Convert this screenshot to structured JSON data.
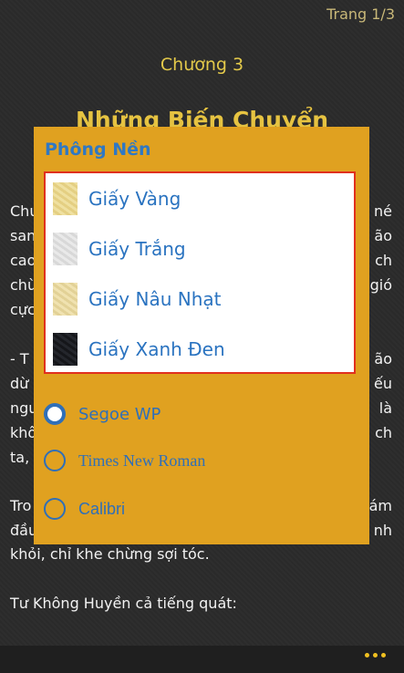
{
  "reader": {
    "page_indicator": "Trang 1/3",
    "chapter_label": "Chương 3",
    "chapter_title": "Những Biến Chuyển",
    "body_left": [
      "Chu",
      "san",
      "cao",
      "chù",
      "cực",
      "-  T",
      "dừ",
      "ngu",
      "khô",
      "ta,",
      "Tro",
      "đầu"
    ],
    "body_right": [
      "né",
      "ão",
      "ch",
      "gió",
      "ão",
      "ếu",
      "là",
      "ch",
      "ám",
      "nh"
    ],
    "line_khoi": "khỏi, chỉ khe chừng sợi tóc.",
    "line_tu": "Tư Không Huyền cả tiếng quát:"
  },
  "dialog": {
    "title": "Phông Nền",
    "backgrounds": [
      {
        "label": "Giấy Vàng",
        "icon": "paper-yellow-swatch"
      },
      {
        "label": "Giấy Trắng",
        "icon": "paper-white-swatch"
      },
      {
        "label": "Giấy Nâu Nhạt",
        "icon": "paper-light-brown-swatch"
      },
      {
        "label": "Giấy Xanh Đen",
        "icon": "paper-navy-black-swatch"
      }
    ],
    "fonts": [
      {
        "label": "Segoe WP",
        "selected": true
      },
      {
        "label": "Times New Roman",
        "selected": false
      },
      {
        "label": "Calibri",
        "selected": false
      }
    ]
  },
  "colors": {
    "dialog_bg": "#e0a120",
    "accent_blue": "#2f78c4",
    "highlight_border": "#e0301e",
    "app_bar_dots": "#f0c020"
  }
}
